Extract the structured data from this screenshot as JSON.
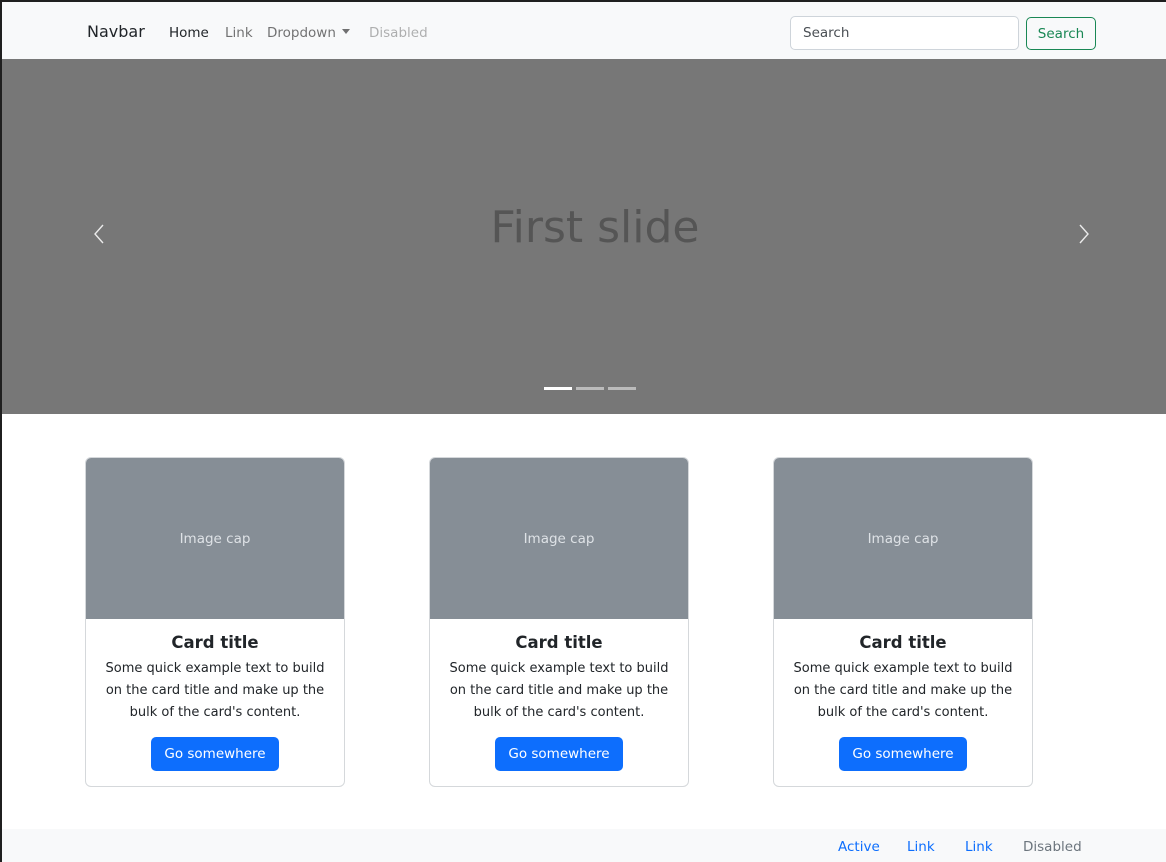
{
  "navbar": {
    "brand": "Navbar",
    "links": [
      {
        "label": "Home",
        "state": "active"
      },
      {
        "label": "Link",
        "state": "normal"
      },
      {
        "label": "Dropdown",
        "state": "normal"
      },
      {
        "label": "Disabled",
        "state": "disabled"
      }
    ],
    "search": {
      "placeholder": "Search",
      "value": ""
    },
    "search_button": "Search"
  },
  "carousel": {
    "slide_text": "First slide",
    "prev_icon": "chevron-left-icon",
    "next_icon": "chevron-right-icon",
    "indicator_count": 3,
    "active_indicator": 0
  },
  "cards": [
    {
      "image_label": "Image cap",
      "title": "Card title",
      "text": "Some quick example text to build on the card title and make up the bulk of the card's content.",
      "button": "Go somewhere"
    },
    {
      "image_label": "Image cap",
      "title": "Card title",
      "text": "Some quick example text to build on the card title and make up the bulk of the card's content.",
      "button": "Go somewhere"
    },
    {
      "image_label": "Image cap",
      "title": "Card title",
      "text": "Some quick example text to build on the card title and make up the bulk of the card's content.",
      "button": "Go somewhere"
    }
  ],
  "footer": {
    "links": [
      {
        "label": "Active",
        "state": "active"
      },
      {
        "label": "Link",
        "state": "normal"
      },
      {
        "label": "Link",
        "state": "normal"
      },
      {
        "label": "Disabled",
        "state": "disabled"
      }
    ]
  },
  "colors": {
    "primary": "#0d6efd",
    "success": "#198754",
    "carousel_bg": "#777777",
    "card_image_bg": "#868e96",
    "navbar_bg": "#f8f9fa"
  }
}
